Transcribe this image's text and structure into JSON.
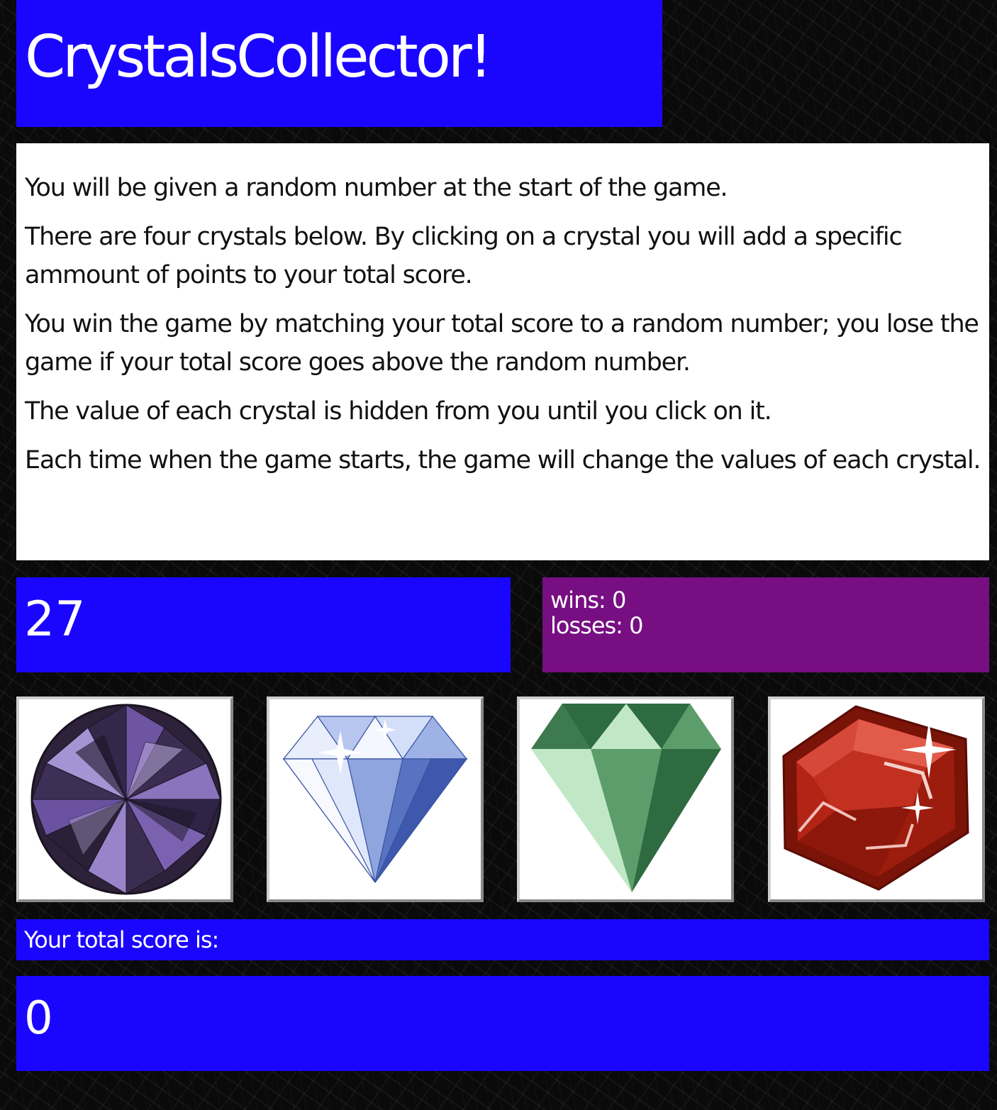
{
  "header": {
    "title": "CrystalsCollector!"
  },
  "instructions": [
    "You will be given a random number at the start of the game.",
    "There are four crystals below. By clicking on a crystal you will add a specific ammount of points to your total score.",
    "You win the game by matching your total score to a random number; you lose the game if your total score goes above the random number.",
    "The value of each crystal is hidden from you until you click on it.",
    "Each time when the game starts, the game will change the values of each crystal."
  ],
  "target": {
    "value": "27"
  },
  "stats": {
    "wins": "wins: 0",
    "losses": "losses: 0"
  },
  "crystals": [
    {
      "name": "purple-round-gem",
      "color": "#5b3d8c"
    },
    {
      "name": "blue-diamond",
      "color": "#7f95d6"
    },
    {
      "name": "green-emerald",
      "color": "#3f8a55"
    },
    {
      "name": "red-ruby",
      "color": "#b22416"
    }
  ],
  "score": {
    "label": "Your total score is:",
    "value": "0"
  },
  "colors": {
    "primary": "#1a06ff",
    "stats": "#770f83",
    "background": "#0a0a0a"
  }
}
